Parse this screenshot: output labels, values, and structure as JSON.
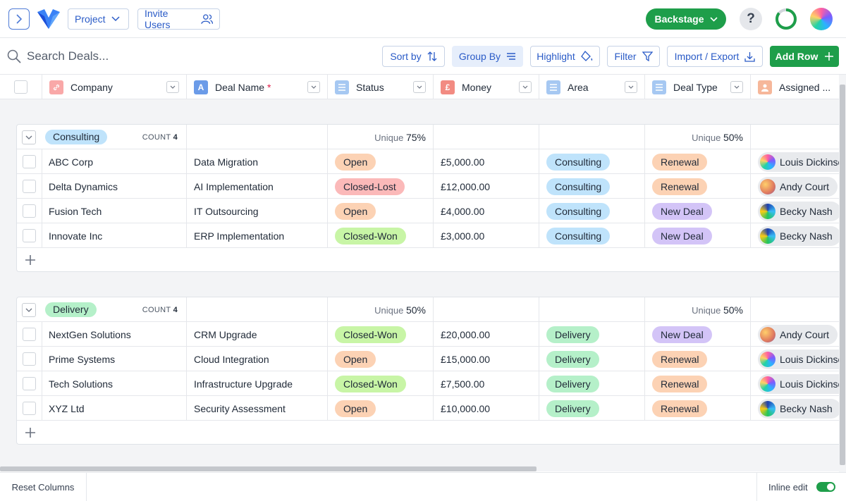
{
  "header": {
    "project_label": "Project",
    "invite_label": "Invite Users",
    "backstage_label": "Backstage",
    "help_glyph": "?"
  },
  "toolbar": {
    "search_placeholder": "Search Deals...",
    "sort_label": "Sort by",
    "group_label": "Group By",
    "highlight_label": "Highlight",
    "filter_label": "Filter",
    "import_label": "Import / Export",
    "addrow_label": "Add Row"
  },
  "columns": [
    {
      "label": "Company",
      "icon": "link-icon",
      "color": "#f28b82",
      "required": false
    },
    {
      "label": "Deal Name",
      "icon": "text-a-icon",
      "color": "#6b9be8",
      "required": true
    },
    {
      "label": "Status",
      "icon": "list-icon",
      "color": "#a6c8f2",
      "required": false
    },
    {
      "label": "Money",
      "icon": "pound-icon",
      "color": "#f28b82",
      "required": false
    },
    {
      "label": "Area",
      "icon": "list-icon",
      "color": "#a6c8f2",
      "required": false
    },
    {
      "label": "Deal Type",
      "icon": "list-icon",
      "color": "#a6c8f2",
      "required": false
    },
    {
      "label": "Assigned ...",
      "icon": "person-icon",
      "color": "#f6b79a",
      "required": false
    }
  ],
  "required_marker": "*",
  "groups": [
    {
      "name": "Consulting",
      "color": "#bfe3fb",
      "count_label": "COUNT",
      "count": "4",
      "unique_label": "Unique",
      "status_unique": "75%",
      "dealtype_unique": "50%",
      "rows": [
        {
          "company": "ABC Corp",
          "deal": "Data Migration",
          "status": "Open",
          "money": "£5,000.00",
          "area": "Consulting",
          "type": "Renewal",
          "assigned": "Louis Dickinson"
        },
        {
          "company": "Delta Dynamics",
          "deal": "AI Implementation",
          "status": "Closed-Lost",
          "money": "£12,000.00",
          "area": "Consulting",
          "type": "Renewal",
          "assigned": "Andy Court"
        },
        {
          "company": "Fusion Tech",
          "deal": "IT Outsourcing",
          "status": "Open",
          "money": "£4,000.00",
          "area": "Consulting",
          "type": "New Deal",
          "assigned": "Becky Nash"
        },
        {
          "company": "Innovate Inc",
          "deal": "ERP Implementation",
          "status": "Closed-Won",
          "money": "£3,000.00",
          "area": "Consulting",
          "type": "New Deal",
          "assigned": "Becky Nash"
        }
      ]
    },
    {
      "name": "Delivery",
      "color": "#b5f0c9",
      "count_label": "COUNT",
      "count": "4",
      "unique_label": "Unique",
      "status_unique": "50%",
      "dealtype_unique": "50%",
      "rows": [
        {
          "company": "NextGen Solutions",
          "deal": "CRM Upgrade",
          "status": "Closed-Won",
          "money": "£20,000.00",
          "area": "Delivery",
          "type": "New Deal",
          "assigned": "Andy Court"
        },
        {
          "company": "Prime Systems",
          "deal": "Cloud Integration",
          "status": "Open",
          "money": "£15,000.00",
          "area": "Delivery",
          "type": "Renewal",
          "assigned": "Louis Dickinson"
        },
        {
          "company": "Tech Solutions",
          "deal": "Infrastructure Upgrade",
          "status": "Closed-Won",
          "money": "£7,500.00",
          "area": "Delivery",
          "type": "Renewal",
          "assigned": "Louis Dickinson"
        },
        {
          "company": "XYZ Ltd",
          "deal": "Security Assessment",
          "status": "Open",
          "money": "£10,000.00",
          "area": "Delivery",
          "type": "Renewal",
          "assigned": "Becky Nash"
        }
      ]
    }
  ],
  "pill_colors": {
    "Open": "#fcd2b4",
    "Closed-Lost": "#fbb9b9",
    "Closed-Won": "#c8f5a6",
    "Consulting": "#bfe3fb",
    "Delivery": "#b5f0c9",
    "Renewal": "#fcd2b4",
    "New Deal": "#d3c4f7"
  },
  "footer": {
    "reset_label": "Reset Columns",
    "inline_edit_label": "Inline edit",
    "inline_edit_on": true
  }
}
